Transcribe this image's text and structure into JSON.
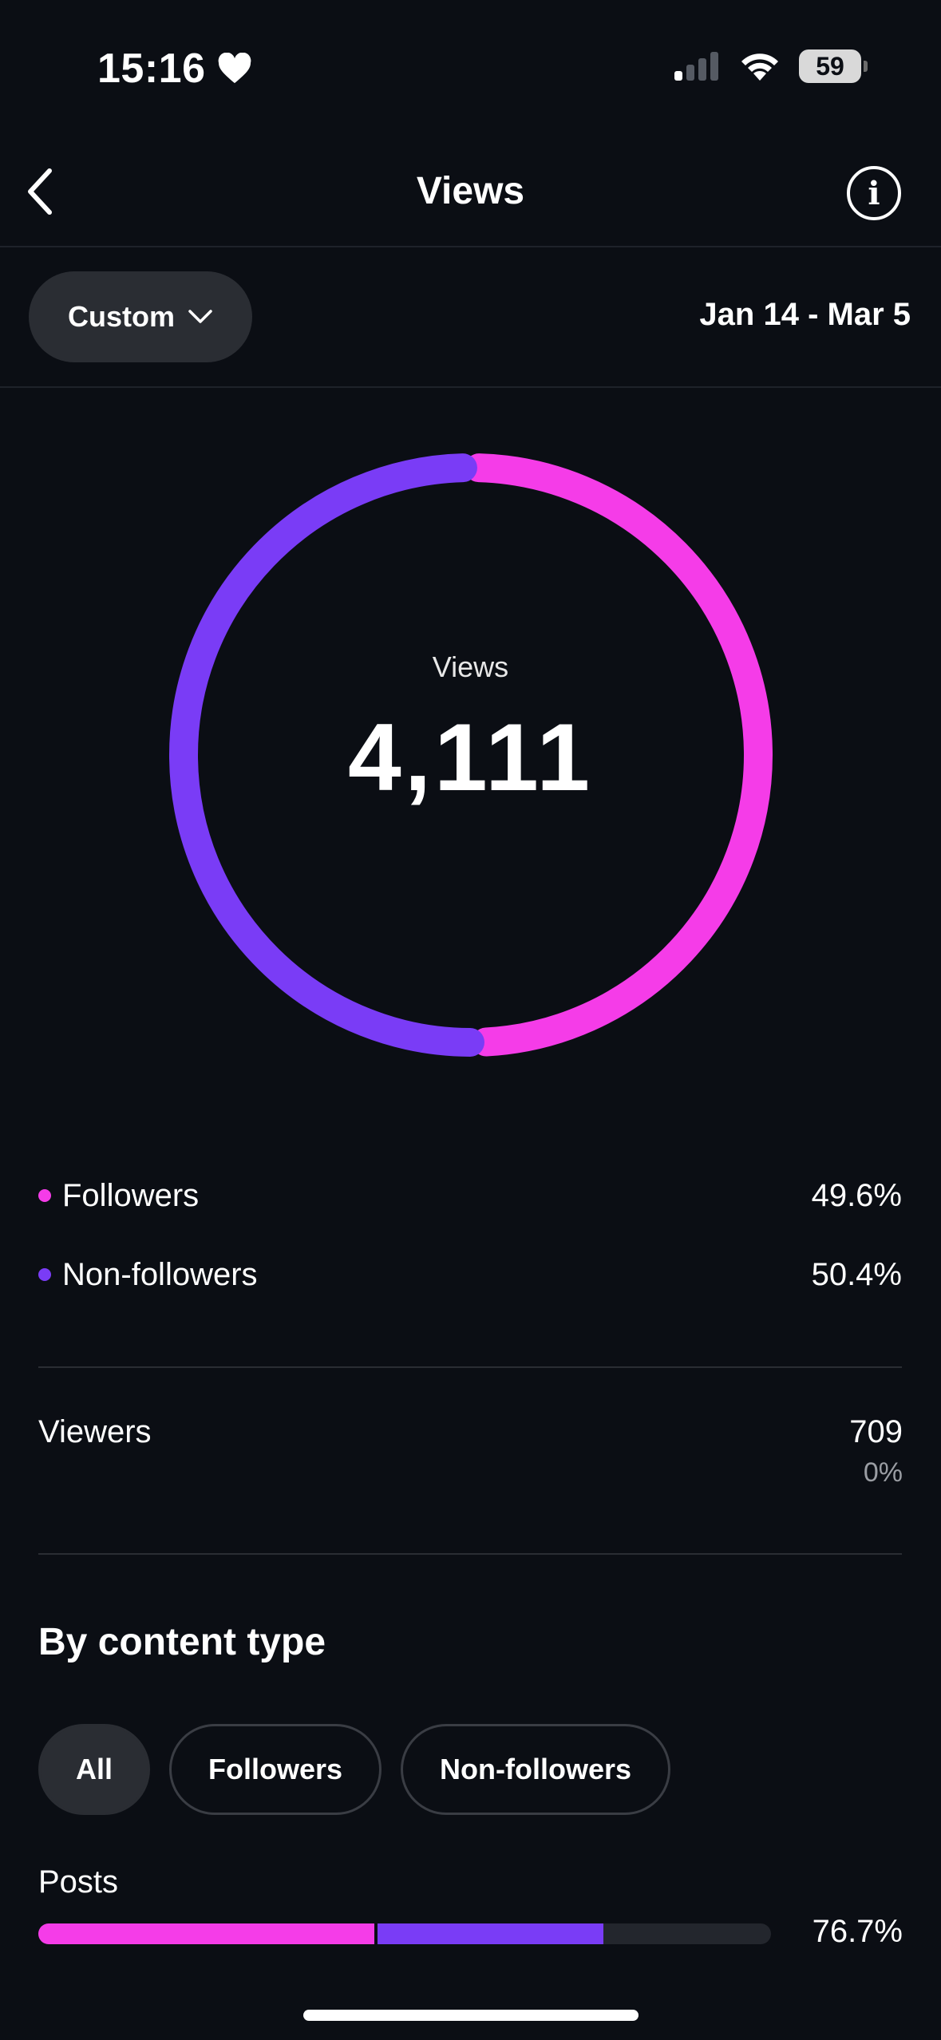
{
  "status_bar": {
    "time": "15:16",
    "battery": "59"
  },
  "header": {
    "title": "Views"
  },
  "filter": {
    "label": "Custom",
    "date_range": "Jan 14 - Mar 5"
  },
  "chart_data": {
    "type": "pie",
    "title": "Views",
    "total": "4,111",
    "slices": [
      {
        "label": "Followers",
        "value": 49.6,
        "color": "#f53ce8"
      },
      {
        "label": "Non-followers",
        "value": 50.4,
        "color": "#7a3cf6"
      }
    ]
  },
  "legend": [
    {
      "label": "Followers",
      "value": "49.6%",
      "color": "#f53ce8"
    },
    {
      "label": "Non-followers",
      "value": "50.4%",
      "color": "#7a3cf6"
    }
  ],
  "viewers": {
    "label": "Viewers",
    "value": "709",
    "change": "0%"
  },
  "content_type": {
    "title": "By content type",
    "chips": [
      "All",
      "Followers",
      "Non-followers"
    ],
    "active_chip": "All",
    "rows": [
      {
        "label": "Posts",
        "percent": "76.7%",
        "followers_fraction": 0.459,
        "non_followers_fraction": 0.308
      }
    ]
  },
  "colors": {
    "followers": "#f53ce8",
    "non_followers": "#7a3cf6",
    "background": "#0b0e14"
  }
}
